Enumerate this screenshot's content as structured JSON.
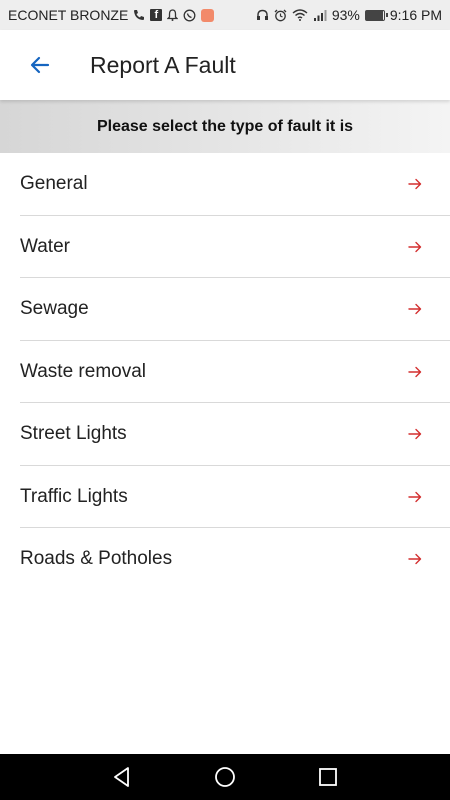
{
  "status_bar": {
    "carrier": "ECONET BRONZE",
    "battery_percent": "93%",
    "battery_level": 0.93,
    "time": "9:16 PM",
    "left_icons": [
      "phone-icon",
      "facebook-icon",
      "bell-icon",
      "whatsapp-icon",
      "app-badge-icon"
    ],
    "right_icons": [
      "headset-icon",
      "alarm-icon",
      "wifi-icon",
      "signal-icon",
      "battery-icon"
    ]
  },
  "header": {
    "title": "Report A Fault",
    "back_icon": "arrow-left-icon"
  },
  "banner": {
    "text": "Please select the type of fault it is"
  },
  "fault_types": [
    {
      "label": "General"
    },
    {
      "label": "Water"
    },
    {
      "label": "Sewage"
    },
    {
      "label": "Waste removal"
    },
    {
      "label": "Street Lights"
    },
    {
      "label": "Traffic Lights"
    },
    {
      "label": "Roads & Potholes"
    }
  ],
  "colors": {
    "accent_blue": "#1565c0",
    "arrow_red": "#d32f2f",
    "status_bar_bg": "#eeeeee",
    "nav_bar_bg": "#000000"
  },
  "nav_bar": {
    "buttons": [
      "back-triangle-icon",
      "home-circle-icon",
      "recents-square-icon"
    ]
  }
}
